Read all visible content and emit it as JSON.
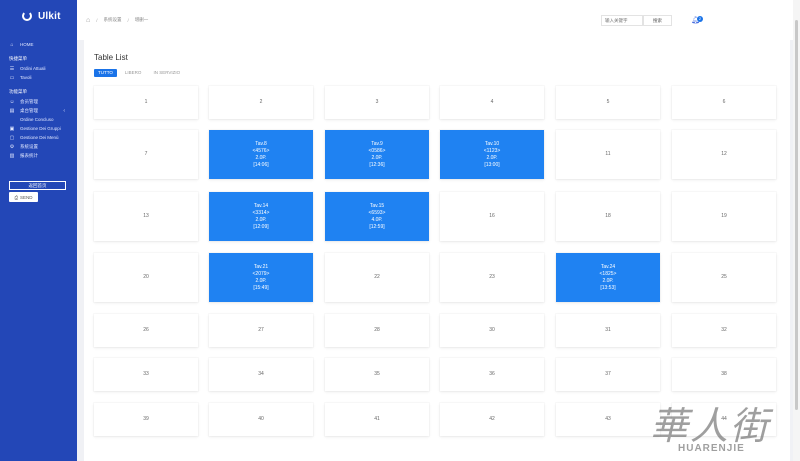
{
  "brand": {
    "name": "Ulkit"
  },
  "sidebar": {
    "home": "HOME",
    "section1": "快捷菜单",
    "section1_items": [
      "Ordini Attuali",
      "Tavoli"
    ],
    "section2": "功能菜单",
    "section2_items": [
      "会员管理",
      "桌台管理",
      "Ordine Concluso",
      "Gestione Dei Gruppi",
      "Gestione Dei Menù",
      "系统设置",
      "报表统计"
    ],
    "home_button": "返回首页",
    "send_button": "SEND"
  },
  "header": {
    "crumbs": [
      "系统设置",
      "增删一"
    ],
    "search_placeholder": "输入关键字",
    "search_button": "搜索",
    "notification_count": "2"
  },
  "main": {
    "title": "Table List",
    "tabs": [
      "TUTTO",
      "LIBERO",
      "IN SERVIZIO"
    ],
    "tables": [
      {
        "label": "1"
      },
      {
        "label": "2"
      },
      {
        "label": "3"
      },
      {
        "label": "4"
      },
      {
        "label": "5"
      },
      {
        "label": "6"
      },
      {
        "label": "7"
      },
      {
        "label": "Tav.8\n<4576>\n2.0P.\n[14:06]",
        "busy": true
      },
      {
        "label": "Tav.9\n<0586>\n2.0P.\n[12:36]",
        "busy": true
      },
      {
        "label": "Tav.10\n<1123>\n2.0P.\n[13:00]",
        "busy": true
      },
      {
        "label": "11"
      },
      {
        "label": "12"
      },
      {
        "label": "13"
      },
      {
        "label": "Tav.14\n<3314>\n2.0P.\n[12:09]",
        "busy": true
      },
      {
        "label": "Tav.15\n<6593>\n4.0P.\n[12:59]",
        "busy": true
      },
      {
        "label": "16"
      },
      {
        "label": "18"
      },
      {
        "label": "19"
      },
      {
        "label": "20"
      },
      {
        "label": "Tav.21\n<2079>\n2.0P.\n[15:49]",
        "busy": true
      },
      {
        "label": "22"
      },
      {
        "label": "23"
      },
      {
        "label": "Tav.24\n<1825>\n2.0P.\n[13:53]",
        "busy": true
      },
      {
        "label": "25"
      },
      {
        "label": "26"
      },
      {
        "label": "27"
      },
      {
        "label": "28"
      },
      {
        "label": "30"
      },
      {
        "label": "31"
      },
      {
        "label": "32"
      },
      {
        "label": "33"
      },
      {
        "label": "34"
      },
      {
        "label": "35"
      },
      {
        "label": "36"
      },
      {
        "label": "37"
      },
      {
        "label": "38"
      },
      {
        "label": "39"
      },
      {
        "label": "40"
      },
      {
        "label": "41"
      },
      {
        "label": "42"
      },
      {
        "label": "43"
      },
      {
        "label": "44"
      }
    ]
  },
  "watermark": {
    "han": "華人街",
    "latin": "HUARENJIE"
  },
  "colors": {
    "sidebar": "#2347b7",
    "accent": "#1a73e8",
    "busy": "#1f82f2"
  }
}
